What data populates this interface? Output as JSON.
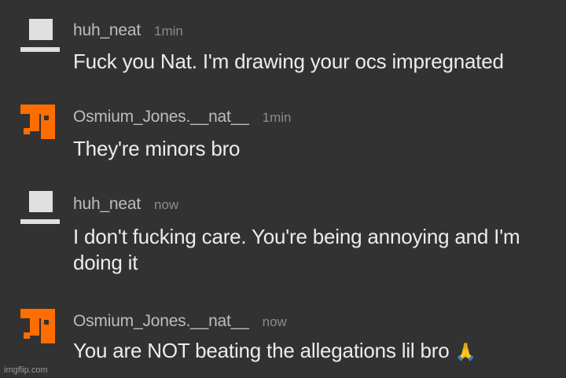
{
  "comments": [
    {
      "username": "huh_neat",
      "time": "1min",
      "text": "Fuck you Nat. I'm drawing your ocs impregnated",
      "avatar_icon": "default-avatar-icon",
      "avatar_color": "#e0e0e0"
    },
    {
      "username": "Osmium_Jones.__nat__",
      "time": "1min",
      "text": "They're minors bro",
      "avatar_icon": "orange-pixel-avatar-icon",
      "avatar_color": "#ff6d00"
    },
    {
      "username": "huh_neat",
      "time": "now",
      "text": "I don't fucking care. You're being annoying and I'm doing it",
      "avatar_icon": "default-avatar-icon",
      "avatar_color": "#e0e0e0"
    },
    {
      "username": "Osmium_Jones.__nat__",
      "time": "now",
      "text": "You are NOT beating the allegations lil bro",
      "emoji": "🙏",
      "avatar_icon": "orange-pixel-avatar-icon",
      "avatar_color": "#ff6d00"
    }
  ],
  "watermark": "imgflip.com",
  "colors": {
    "background": "#323232",
    "username": "#bdbdbd",
    "timestamp": "#8c8c8c",
    "text": "#ececec"
  }
}
